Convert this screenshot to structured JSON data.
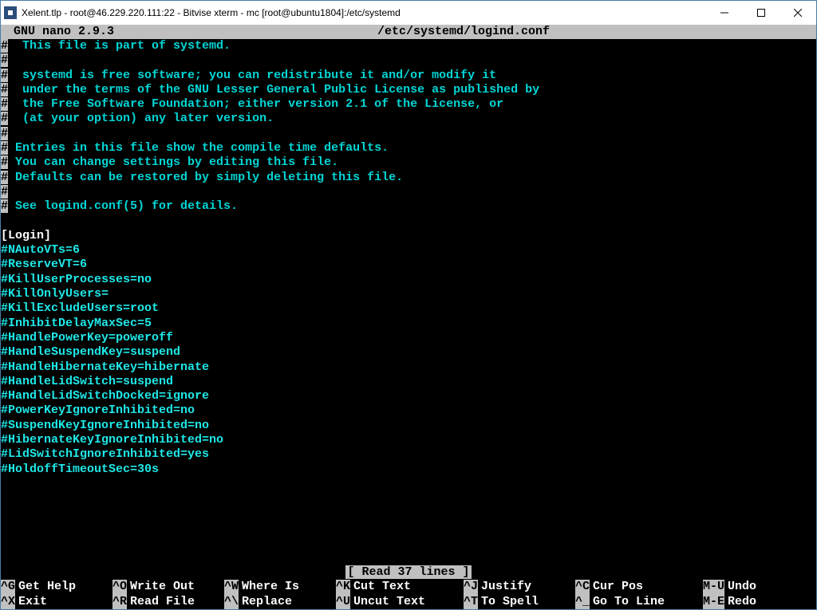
{
  "window": {
    "title": "Xelent.tlp - root@46.229.220.111:22 - Bitvise xterm - mc [root@ubuntu1804]:/etc/systemd"
  },
  "nano": {
    "version": "  GNU nano 2.9.3",
    "filepath": "/etc/systemd/logind.conf",
    "status": "[ Read 37 lines ]"
  },
  "content": {
    "l1": "  This file is part of systemd.",
    "l2": "  systemd is free software; you can redistribute it and/or modify it",
    "l3": "  under the terms of the GNU Lesser General Public License as published by",
    "l4": "  the Free Software Foundation; either version 2.1 of the License, or",
    "l5": "  (at your option) any later version.",
    "l6": " Entries in this file show the compile time defaults.",
    "l7": " You can change settings by editing this file.",
    "l8": " Defaults can be restored by simply deleting this file.",
    "l9": " See logind.conf(5) for details.",
    "section": "[Login]",
    "o1": "#NAutoVTs=6",
    "o2": "#ReserveVT=6",
    "o3": "#KillUserProcesses=no",
    "o4": "#KillOnlyUsers=",
    "o5": "#KillExcludeUsers=root",
    "o6": "#InhibitDelayMaxSec=5",
    "o7": "#HandlePowerKey=poweroff",
    "o8": "#HandleSuspendKey=suspend",
    "o9": "#HandleHibernateKey=hibernate",
    "o10": "#HandleLidSwitch=suspend",
    "o11": "#HandleLidSwitchDocked=ignore",
    "o12": "#PowerKeyIgnoreInhibited=no",
    "o13": "#SuspendKeyIgnoreInhibited=no",
    "o14": "#HibernateKeyIgnoreInhibited=no",
    "o15": "#LidSwitchIgnoreInhibited=yes",
    "o16": "#HoldoffTimeoutSec=30s"
  },
  "shortcuts": {
    "r1": [
      {
        "key": "^G",
        "label": "Get Help"
      },
      {
        "key": "^O",
        "label": "Write Out"
      },
      {
        "key": "^W",
        "label": "Where Is"
      },
      {
        "key": "^K",
        "label": "Cut Text"
      },
      {
        "key": "^J",
        "label": "Justify"
      },
      {
        "key": "^C",
        "label": "Cur Pos"
      },
      {
        "key": "M-U",
        "label": "Undo"
      }
    ],
    "r2": [
      {
        "key": "^X",
        "label": "Exit"
      },
      {
        "key": "^R",
        "label": "Read File"
      },
      {
        "key": "^\\",
        "label": "Replace"
      },
      {
        "key": "^U",
        "label": "Uncut Text"
      },
      {
        "key": "^T",
        "label": "To Spell"
      },
      {
        "key": "^_",
        "label": "Go To Line"
      },
      {
        "key": "M-E",
        "label": "Redo"
      }
    ]
  }
}
